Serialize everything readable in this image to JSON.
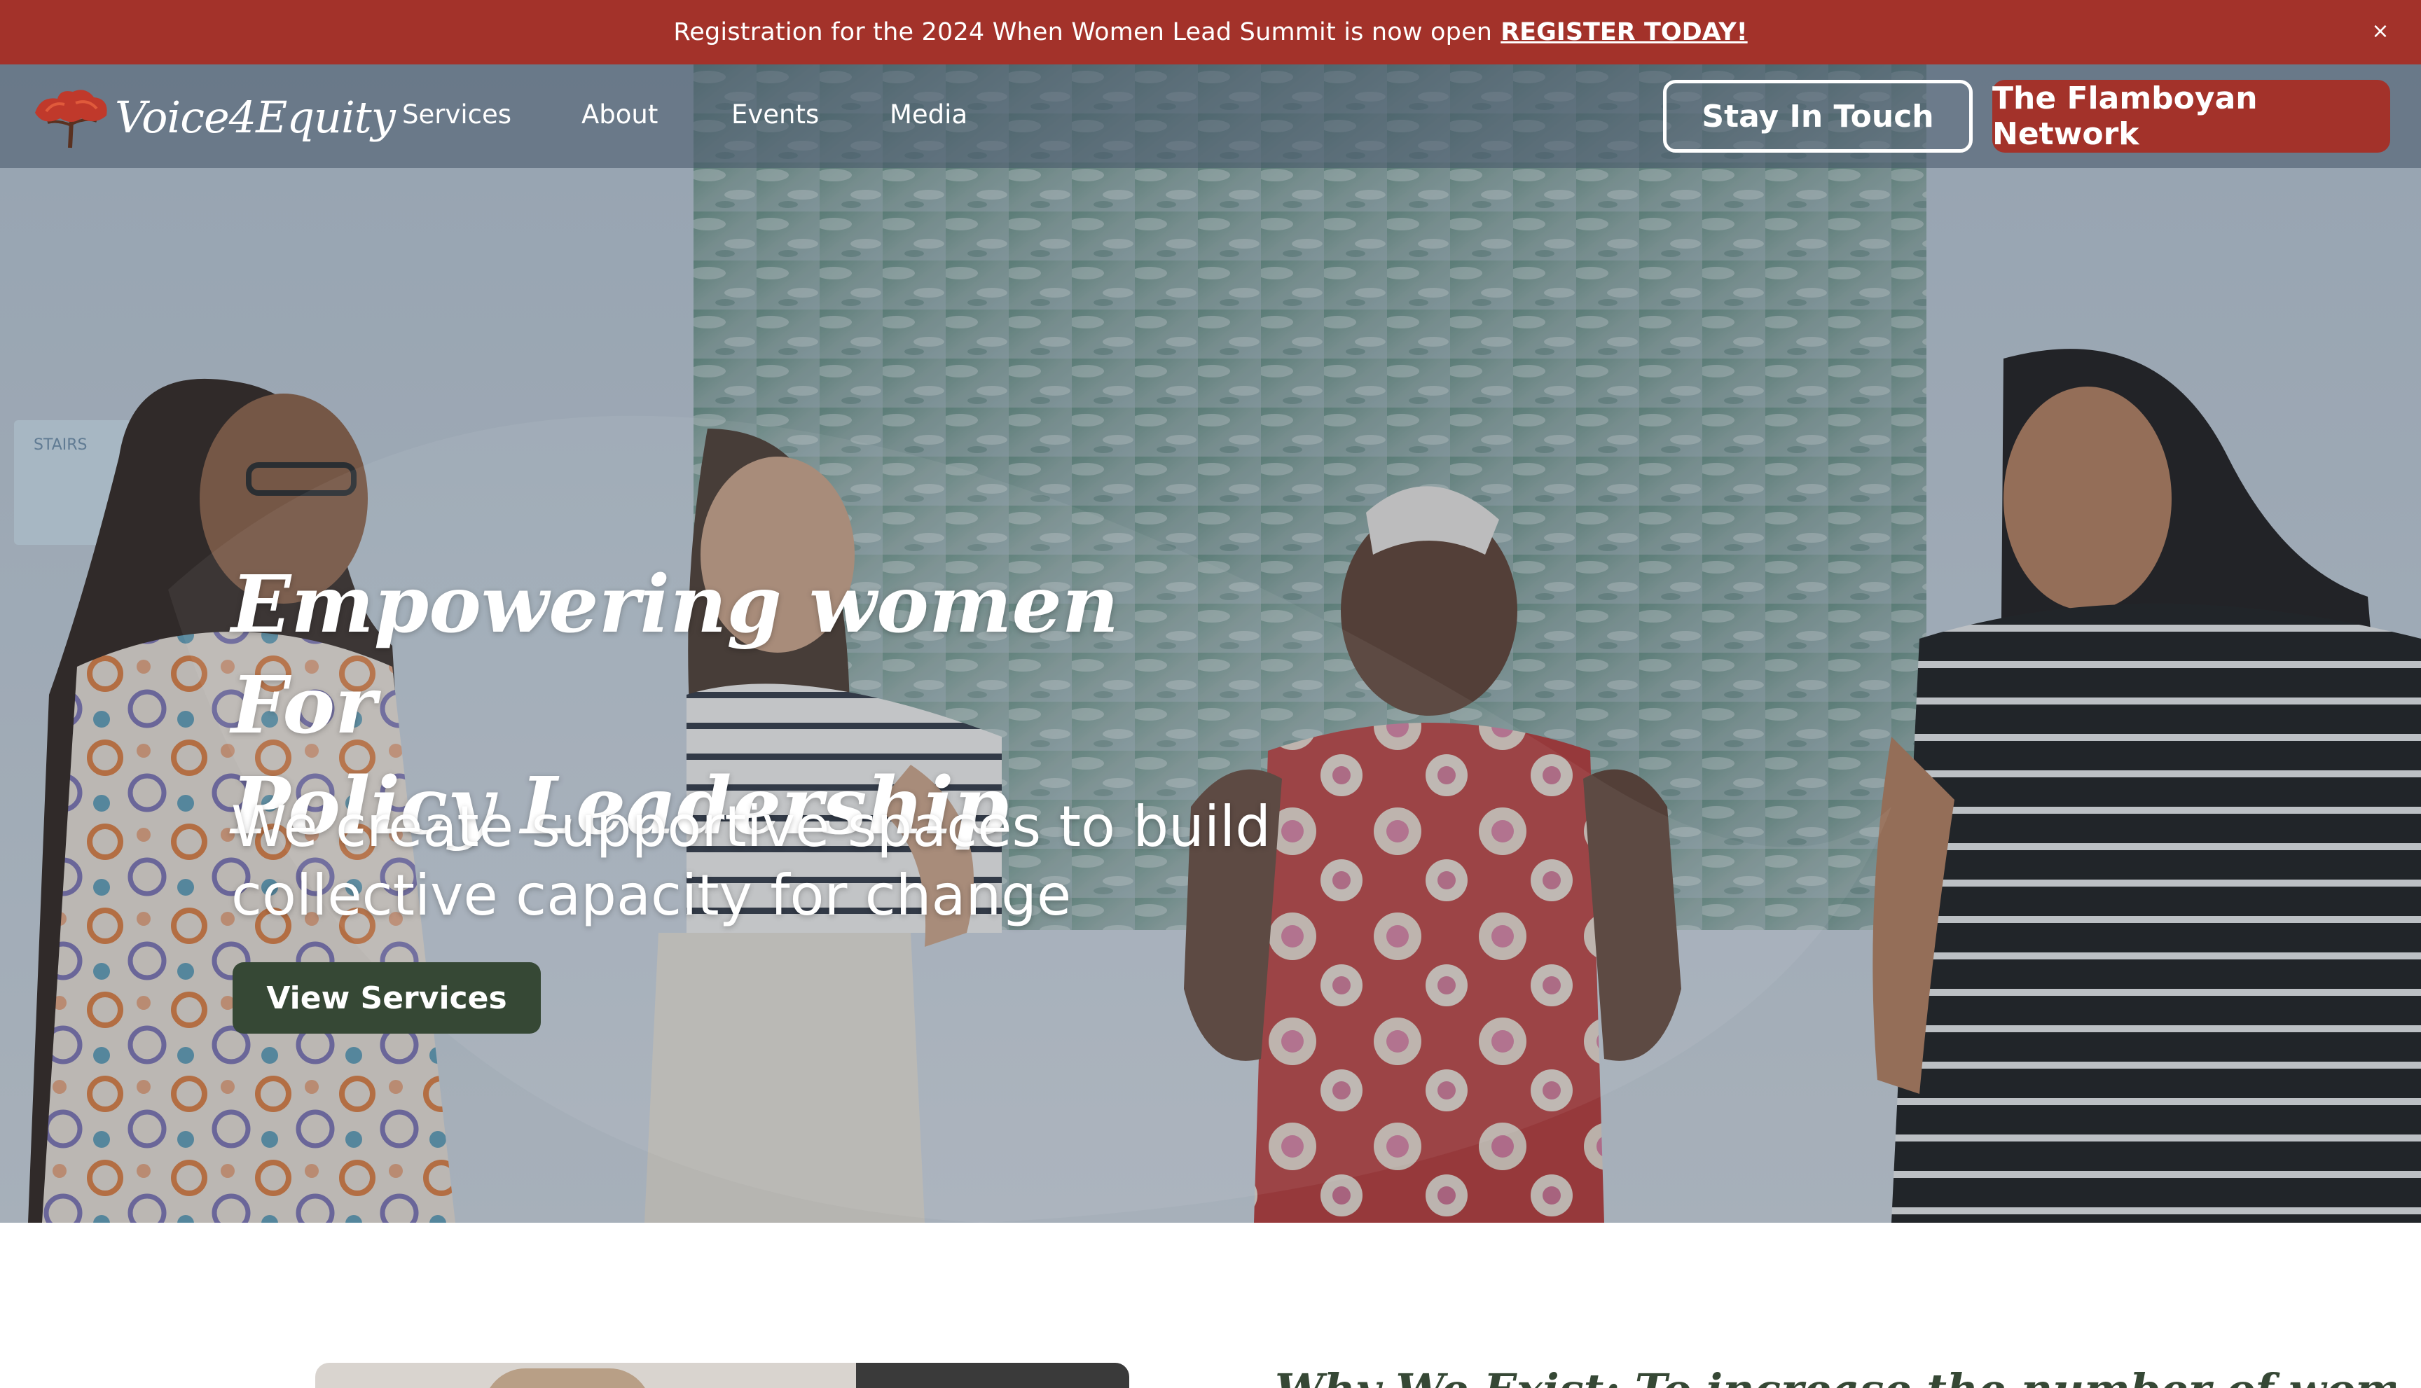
{
  "announcement": {
    "message": "Registration for the 2024 When Women Lead Summit is now open",
    "cta": "REGISTER TODAY!",
    "close": "×",
    "bg_color": "#a3322a"
  },
  "nav": {
    "logo_text": "Voice4Equity",
    "logo_icon": "flamboyan-tree-icon",
    "links": [
      "Services",
      "About",
      "Events",
      "Media"
    ],
    "stay_in_touch": "Stay In Touch",
    "network": "The Flamboyan Network"
  },
  "hero": {
    "title_line1": "Empowering women For",
    "title_line2": "Policy Leadership",
    "subtitle_line1": "We create supportive spaces to build",
    "subtitle_line2": "collective capacity for change",
    "button": "View Services",
    "button_color": "#364835",
    "sign_text": "STAIRS"
  },
  "section": {
    "heading": "Why We Exist: To increase the number of women"
  }
}
